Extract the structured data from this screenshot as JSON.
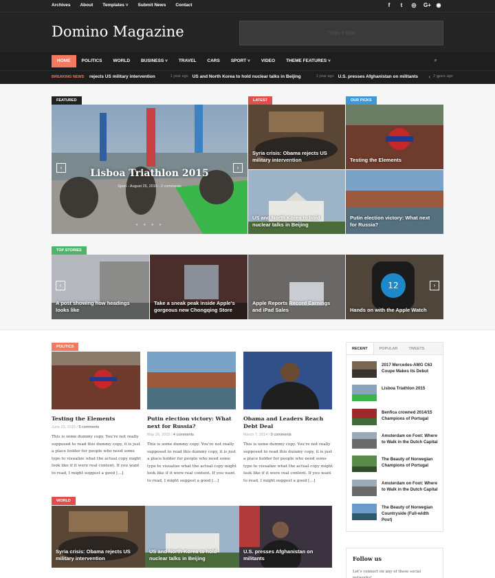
{
  "colors": {
    "accent": "#f27a5e",
    "latest": "#e24e4e",
    "picks": "#3e9ad7",
    "top": "#4ab56b",
    "dark": "#242424"
  },
  "topnav": [
    "Archives",
    "About",
    "Templates ˅",
    "Submit News",
    "Contact"
  ],
  "social_icons": [
    "facebook-icon",
    "twitter-icon",
    "instagram-icon",
    "google-plus-icon",
    "rss-icon"
  ],
  "social_glyphs": [
    "f",
    "t",
    "◎",
    "G+",
    "◉"
  ],
  "site_title": "Domino Magazine",
  "ad_text": "728px x 90px",
  "nav": [
    "HOME",
    "POLITICS",
    "WORLD",
    "BUSINESS ˅",
    "TRAVEL",
    "CARS",
    "SPORT ˅",
    "VIDEO",
    "THEME FEATURES ˅"
  ],
  "nav_search_icon": "⌕",
  "ticker": {
    "label": "BREAKING NEWS",
    "items": [
      {
        "ago": "",
        "title": "rejects US military intervention"
      },
      {
        "ago": "1 year ago",
        "title": "US and North Korea to hold nuclear talks in Beijing"
      },
      {
        "ago": "1 year ago",
        "title": "U.S. presses Afghanistan on militants"
      },
      {
        "ago": "2 years ago",
        "title": ""
      }
    ],
    "arrows": "‹ ›"
  },
  "featured": {
    "badge": "FEATURED",
    "title": "Lisboa Triathlon 2015",
    "meta": "Sport  -  August 25, 2015  -  2 comments",
    "prev": "‹",
    "next": "›",
    "dots": "● ● ● ●"
  },
  "latest": {
    "badge": "LATEST",
    "items": [
      "Syria crisis: Obama rejects US military intervention",
      "US and North Korea to hold nuclear talks in Beijing"
    ]
  },
  "picks": {
    "badge": "OUR PICKS",
    "items": [
      "Testing the Elements",
      "Putin election victory: What next for Russia?"
    ]
  },
  "top_stories": {
    "badge": "TOP STORIES",
    "prev": "‹",
    "next": "›",
    "items": [
      "A post showing how headings looks like",
      "Take a sneak peak inside Apple's gorgeous new Chongqing Store",
      "Apple Reports Record Earnings and iPad Sales",
      "Hands on with the Apple Watch"
    ]
  },
  "politics": {
    "badge": "POLITICS",
    "posts": [
      {
        "title": "Testing the Elements",
        "date": "June 23, 2015",
        "comments": "5 comments",
        "excerpt": "This is some dummy copy. You're not really supposed to read this dummy copy, it is just a place holder for people who need some type to visualize what the actual copy might look like if it were real content. If you want to read, I might suggest a good […]"
      },
      {
        "title": "Putin election victory: What next for Russia?",
        "date": "May 26, 2015",
        "comments": "4 comments",
        "excerpt": "This is some dummy copy. You're not really supposed to read this dummy copy, it is just a place holder for people who need some type to visualize what the actual copy might look like if it were real content. If you want to read, I might suggest a good […]"
      },
      {
        "title": "Obama and Leaders Reach Debt Deal",
        "date": "March 7, 2014",
        "comments": "0 comments",
        "excerpt": "This is some dummy copy. You're not really supposed to read this dummy copy, it is just a place holder for people who need some type to visualize what the actual copy might look like if it were real content. If you want to read, I might suggest a good […]"
      }
    ]
  },
  "world": {
    "badge": "WORLD",
    "items": [
      "Syria crisis: Obama rejects US military intervention",
      "US and North Korea to hold nuclear talks in Beijing",
      "U.S. presses Afghanistan on militants"
    ]
  },
  "sidebar": {
    "tabs": [
      "RECENT",
      "POPULAR",
      "TWEETS"
    ],
    "items": [
      "2017 Mercedes-AMG C63 Coupe Makes its Debut",
      "Lisboa Triathlon 2015",
      "Benfica crowned 2014/15 Champions of Portugal",
      "Amsterdam on Foot: Where to Walk in the Dutch Capital",
      "The Beauty of Norwegian Champions of Portugal",
      "Amsterdam on Foot: Where to Walk in the Dutch Capital",
      "The Beauty of Norwegian Countryside (Full-width Post)"
    ]
  },
  "follow": {
    "title": "Follow us",
    "text": "Let's connect on any of these social networks!"
  }
}
